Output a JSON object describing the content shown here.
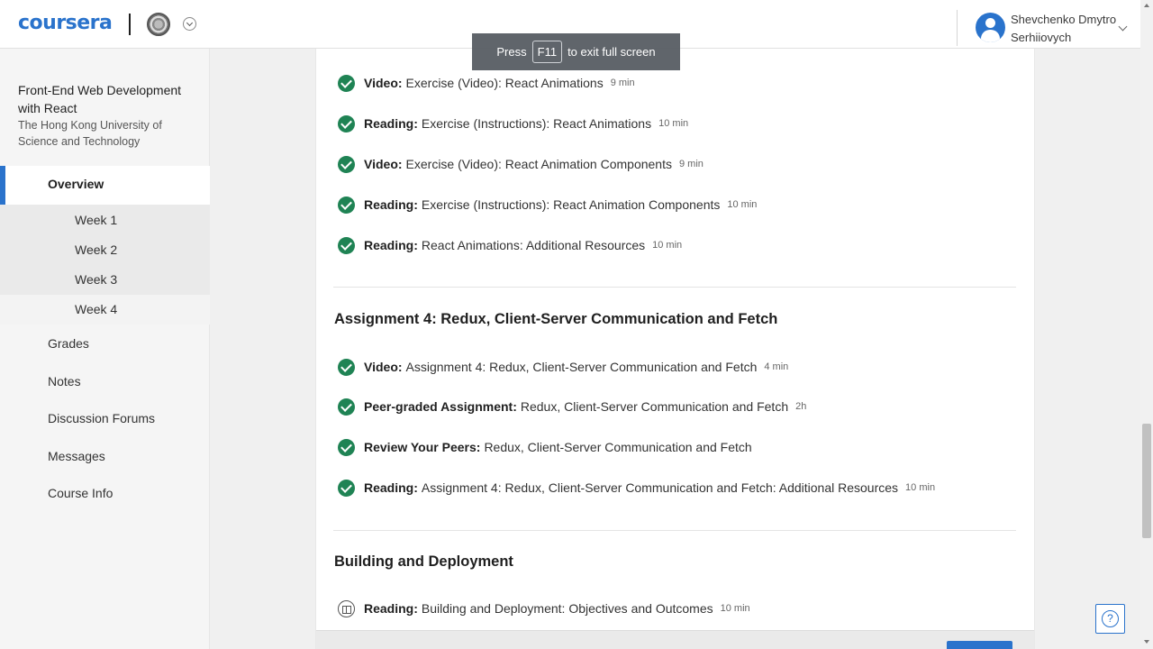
{
  "header": {
    "logo_text": "coursera",
    "user_name": "Shevchenko Dmytro Serhiiovych"
  },
  "sidebar": {
    "course_title": "Front-End Web Development with React",
    "university": "The Hong Kong University of Science and Technology",
    "overview": "Overview",
    "weeks": [
      "Week 1",
      "Week 2",
      "Week 3",
      "Week 4"
    ],
    "items": [
      "Grades",
      "Notes",
      "Discussion Forums",
      "Messages",
      "Course Info"
    ]
  },
  "toast": {
    "prefix": "Press",
    "key": "F11",
    "suffix": "to exit full screen"
  },
  "lessons_top": [
    {
      "type": "Video:",
      "title": "Exercise (Video): React Animations",
      "duration": "9 min",
      "status": "completed"
    },
    {
      "type": "Reading:",
      "title": "Exercise (Instructions): React Animations",
      "duration": "10 min",
      "status": "completed"
    },
    {
      "type": "Video:",
      "title": "Exercise (Video): React Animation Components",
      "duration": "9 min",
      "status": "completed"
    },
    {
      "type": "Reading:",
      "title": "Exercise (Instructions): React Animation Components",
      "duration": "10 min",
      "status": "completed"
    },
    {
      "type": "Reading:",
      "title": "React Animations: Additional Resources",
      "duration": "10 min",
      "status": "completed"
    }
  ],
  "section_assignment4": {
    "title": "Assignment 4: Redux, Client-Server Communication and Fetch",
    "lessons": [
      {
        "type": "Video:",
        "title": "Assignment 4: Redux, Client-Server Communication and Fetch",
        "duration": "4 min",
        "status": "completed"
      },
      {
        "type": "Peer-graded Assignment:",
        "title": "Redux, Client-Server Communication and Fetch",
        "duration": "2h",
        "status": "completed"
      },
      {
        "type": "Review Your Peers:",
        "title": "Redux, Client-Server Communication and Fetch",
        "duration": "",
        "status": "completed"
      },
      {
        "type": "Reading:",
        "title": "Assignment 4: Redux, Client-Server Communication and Fetch: Additional Resources",
        "duration": "10 min",
        "status": "completed"
      }
    ]
  },
  "section_building": {
    "title": "Building and Deployment",
    "lessons": [
      {
        "type": "Reading:",
        "title": "Building and Deployment: Objectives and Outcomes",
        "duration": "10 min",
        "status": "not-started"
      }
    ]
  },
  "help": {
    "label": "?"
  },
  "colors": {
    "brand": "#2a73cc",
    "completed": "#1f8354"
  }
}
